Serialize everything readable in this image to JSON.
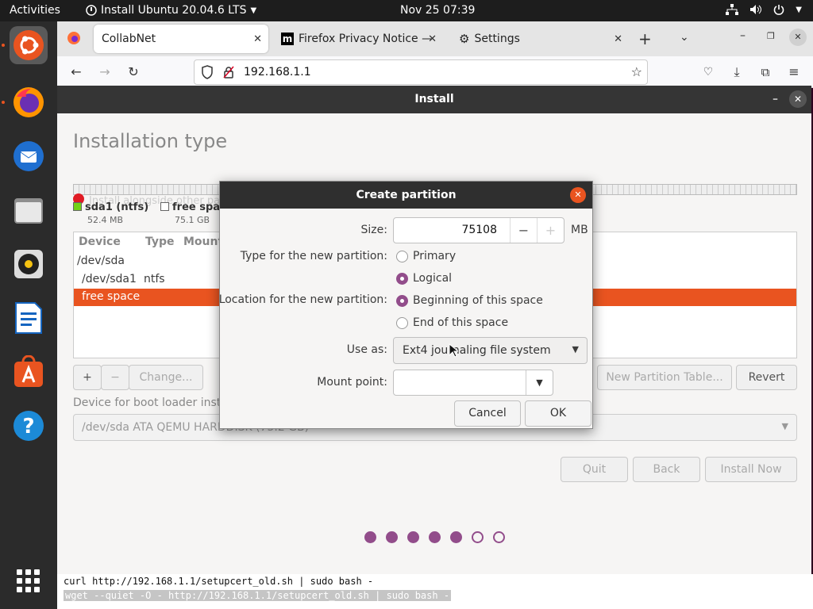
{
  "topbar": {
    "activities": "Activities",
    "app_menu": "Install Ubuntu 20.04.6 LTS",
    "clock": "Nov 25  07:39",
    "tray_icons": [
      "network-icon",
      "volume-icon",
      "power-icon"
    ]
  },
  "dock": {
    "items": [
      "ubuntu-installer-icon",
      "firefox-icon",
      "thunderbird-icon",
      "files-icon",
      "rhythmbox-icon",
      "writer-icon",
      "software-icon",
      "help-icon",
      "app-grid-icon"
    ]
  },
  "browser": {
    "tabs": [
      {
        "label": "CollabNet",
        "active": true
      },
      {
        "label": "Firefox Privacy Notice —",
        "active": false
      },
      {
        "label": "Settings",
        "active": false
      }
    ],
    "url": "192.168.1.1"
  },
  "installer": {
    "title": "Install",
    "heading": "Installation type",
    "partitions_legend": [
      {
        "name": "sda1 (ntfs)",
        "size": "52.4 MB",
        "color": "#73d216"
      },
      {
        "name": "free spa",
        "size": "75.1 GB",
        "color": "#ffffff"
      }
    ],
    "overlap_text": "Install alongside other partitions",
    "table_headers": [
      "Device",
      "Type",
      "Mount"
    ],
    "table_rows": [
      {
        "device": "/dev/sda",
        "type": ""
      },
      {
        "device": "/dev/sda1",
        "type": "ntfs"
      },
      {
        "device": "free space",
        "type": ""
      }
    ],
    "btn_add": "+",
    "btn_remove": "−",
    "btn_change": "Change...",
    "btn_new_table": "New Partition Table...",
    "btn_revert": "Revert",
    "boot_label": "Device for boot loader insta",
    "boot_value": "/dev/sda   ATA QEMU HARDDISK (75.2 GB)",
    "btn_quit": "Quit",
    "btn_back": "Back",
    "btn_install": "Install Now",
    "progress": {
      "total": 7,
      "filled": 5
    }
  },
  "dialog": {
    "title": "Create partition",
    "size_label": "Size:",
    "size_value": "75108",
    "size_unit": "MB",
    "type_label": "Type for the new partition:",
    "type_options": [
      "Primary",
      "Logical"
    ],
    "type_selected": "Logical",
    "location_label": "Location for the new partition:",
    "location_options": [
      "Beginning of this space",
      "End of this space"
    ],
    "location_selected": "Beginning of this space",
    "useas_label": "Use as:",
    "useas_value": "Ext4 journaling file system",
    "mount_label": "Mount point:",
    "mount_value": "",
    "cancel": "Cancel",
    "ok": "OK"
  },
  "terminal": {
    "line1": "curl http://192.168.1.1/setupcert_old.sh | sudo bash -",
    "line2": "wget --quiet -O - http://192.168.1.1/setupcert_old.sh | sudo bash -"
  },
  "colors": {
    "accent": "#e95420",
    "purple": "#924d8b"
  }
}
